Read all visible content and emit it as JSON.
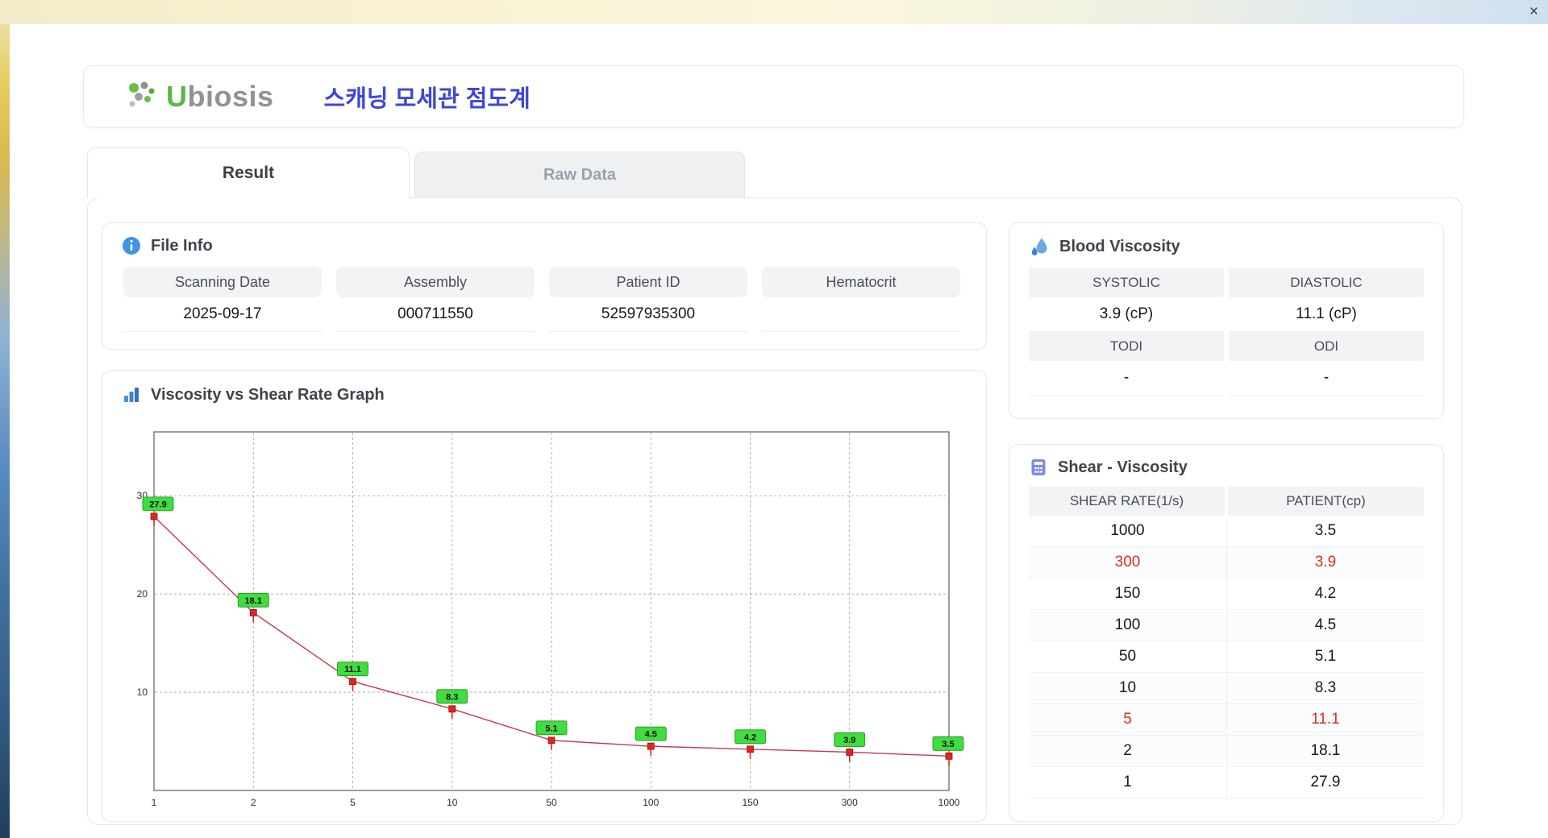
{
  "window": {
    "close_label": "×"
  },
  "header": {
    "brand_u": "U",
    "brand_rest": "biosis",
    "title": "스캐닝 모세관 점도계"
  },
  "tabs": [
    {
      "label": "Result"
    },
    {
      "label": "Raw Data"
    }
  ],
  "file_info": {
    "title": "File Info",
    "fields": [
      {
        "label": "Scanning Date",
        "value": "2025-09-17"
      },
      {
        "label": "Assembly",
        "value": "000711550"
      },
      {
        "label": "Patient ID",
        "value": "52597935300"
      },
      {
        "label": "Hematocrit",
        "value": ""
      }
    ]
  },
  "blood_viscosity": {
    "title": "Blood Viscosity",
    "rows": [
      {
        "headers": [
          "SYSTOLIC",
          "DIASTOLIC"
        ],
        "values": [
          "3.9 (cP)",
          "11.1 (cP)"
        ]
      },
      {
        "headers": [
          "TODI",
          "ODI"
        ],
        "values": [
          "-",
          "-"
        ]
      }
    ]
  },
  "shear_viscosity": {
    "title": "Shear - Viscosity",
    "columns": [
      "SHEAR RATE(1/s)",
      "PATIENT(cp)"
    ],
    "rows": [
      {
        "shear": "1000",
        "patient": "3.5",
        "highlight": false
      },
      {
        "shear": "300",
        "patient": "3.9",
        "highlight": true
      },
      {
        "shear": "150",
        "patient": "4.2",
        "highlight": false
      },
      {
        "shear": "100",
        "patient": "4.5",
        "highlight": false
      },
      {
        "shear": "50",
        "patient": "5.1",
        "highlight": false
      },
      {
        "shear": "10",
        "patient": "8.3",
        "highlight": false
      },
      {
        "shear": "5",
        "patient": "11.1",
        "highlight": true
      },
      {
        "shear": "2",
        "patient": "18.1",
        "highlight": false
      },
      {
        "shear": "1",
        "patient": "27.9",
        "highlight": false
      }
    ]
  },
  "chart_data": {
    "type": "line",
    "title": "Viscosity vs Shear Rate Graph",
    "xlabel": "",
    "ylabel": "",
    "x_axis_type": "categorical",
    "x_tick_labels": [
      "1",
      "2",
      "5",
      "10",
      "50",
      "100",
      "150",
      "300",
      "1000"
    ],
    "values": [
      27.9,
      18.1,
      11.1,
      8.3,
      5.1,
      4.5,
      4.2,
      3.9,
      3.5
    ],
    "point_labels": [
      "27.9",
      "18.1",
      "11.1",
      "8.3",
      "5.1",
      "4.5",
      "4.2",
      "3.9",
      "3.5"
    ],
    "y_ticks": [
      10,
      20,
      30
    ],
    "ylim": [
      0,
      36.5
    ],
    "grid": true,
    "legend": false,
    "line_color": "#c43a4b",
    "marker_color": "#e02424",
    "label_bg": "#3fdd3f",
    "label_border": "#1f8a1f"
  },
  "colors": {
    "accent_blue": "#4146d9",
    "brand_green": "#5cb648",
    "highlight_red": "#d93025"
  }
}
